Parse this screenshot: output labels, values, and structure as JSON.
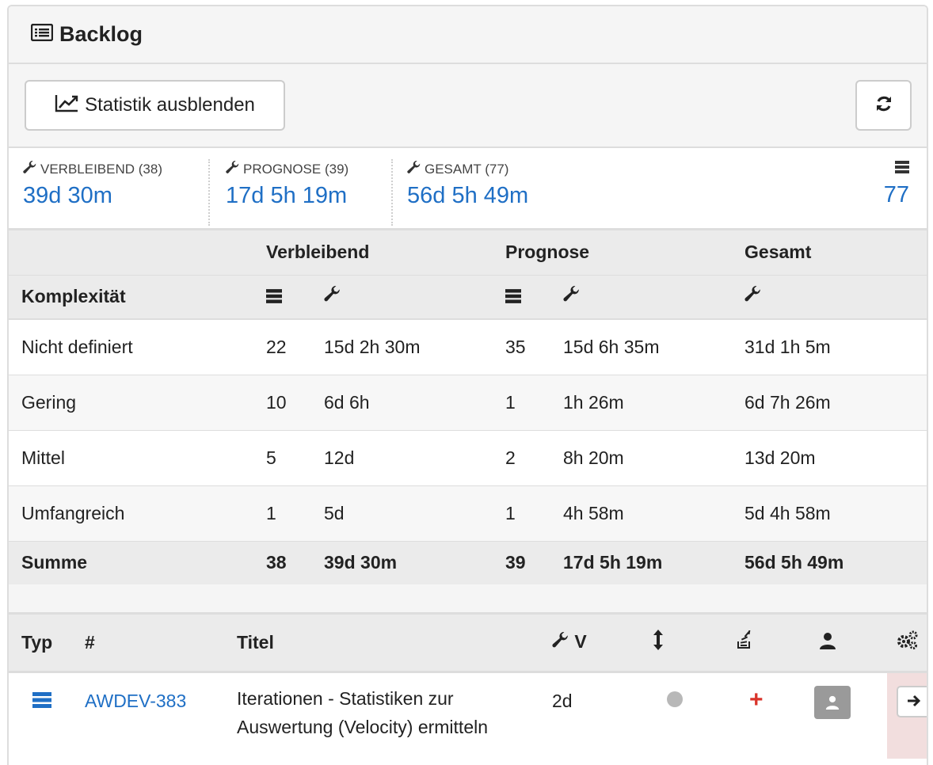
{
  "panel": {
    "title": "Backlog"
  },
  "toolbar": {
    "stats_toggle_label": "Statistik ausblenden"
  },
  "summary": {
    "remaining": {
      "label": "VERBLEIBEND (38)",
      "value": "39d 30m"
    },
    "forecast": {
      "label": "PROGNOSE (39)",
      "value": "17d 5h 19m"
    },
    "total": {
      "label": "GESAMT (77)",
      "value": "56d 5h 49m"
    },
    "count": {
      "value": "77"
    }
  },
  "stats_table": {
    "group_headers": {
      "remaining": "Verbleibend",
      "forecast": "Prognose",
      "total": "Gesamt"
    },
    "complexity_header": "Komplexität",
    "rows": [
      {
        "label": "Nicht definiert",
        "rem_count": "22",
        "rem_time": "15d 2h 30m",
        "fc_count": "35",
        "fc_time": "15d 6h 35m",
        "total_time": "31d 1h 5m"
      },
      {
        "label": "Gering",
        "rem_count": "10",
        "rem_time": "6d 6h",
        "fc_count": "1",
        "fc_time": "1h 26m",
        "total_time": "6d 7h 26m"
      },
      {
        "label": "Mittel",
        "rem_count": "5",
        "rem_time": "12d",
        "fc_count": "2",
        "fc_time": "8h 20m",
        "total_time": "13d 20m"
      },
      {
        "label": "Umfangreich",
        "rem_count": "1",
        "rem_time": "5d",
        "fc_count": "1",
        "fc_time": "4h 58m",
        "total_time": "5d 4h 58m"
      }
    ],
    "sum": {
      "label": "Summe",
      "rem_count": "38",
      "rem_time": "39d 30m",
      "fc_count": "39",
      "fc_time": "17d 5h 19m",
      "total_time": "56d 5h 49m"
    }
  },
  "backlog_table": {
    "headers": {
      "type": "Typ",
      "number": "#",
      "title": "Titel",
      "remaining": "V"
    },
    "items": [
      {
        "key": "AWDEV-383",
        "title": "Iterationen - Statistiken zur Auswertung (Velocity) ermitteln",
        "remaining": "2d"
      }
    ]
  },
  "colors": {
    "link": "#1f6fc5",
    "plus": "#d9342b",
    "action_bg": "#f2dede"
  },
  "icons": [
    "list-icon",
    "line-chart-icon",
    "refresh-icon",
    "wrench-icon",
    "stack-icon",
    "sort-icon",
    "stackoverflow-icon",
    "user-icon",
    "cogs-icon",
    "arrow-right-icon"
  ]
}
